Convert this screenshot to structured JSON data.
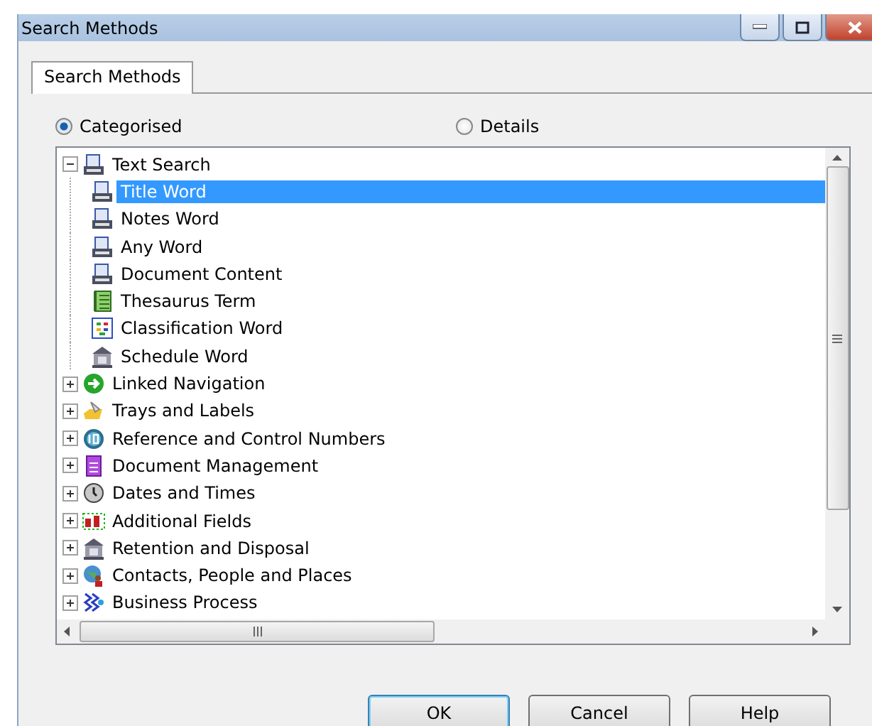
{
  "window": {
    "title": "Search Methods"
  },
  "tabs": [
    {
      "label": "Search Methods",
      "selected": true
    }
  ],
  "view_options": [
    {
      "label": "Categorised",
      "selected": true
    },
    {
      "label": "Details",
      "selected": false
    }
  ],
  "tree": [
    {
      "label": "Text Search",
      "kind": "text",
      "expanded": true,
      "selected": false,
      "children": [
        {
          "label": "Title Word",
          "kind": "text",
          "selected": true
        },
        {
          "label": "Notes Word",
          "kind": "text",
          "selected": false
        },
        {
          "label": "Any Word",
          "kind": "text",
          "selected": false
        },
        {
          "label": "Document Content",
          "kind": "text",
          "selected": false
        },
        {
          "label": "Thesaurus Term",
          "kind": "thesaurus",
          "selected": false
        },
        {
          "label": "Classification Word",
          "kind": "classification",
          "selected": false
        },
        {
          "label": "Schedule Word",
          "kind": "building",
          "selected": false
        }
      ]
    },
    {
      "label": "Linked Navigation",
      "kind": "arrow",
      "expanded": false,
      "selected": false
    },
    {
      "label": "Trays and Labels",
      "kind": "tray",
      "expanded": false,
      "selected": false
    },
    {
      "label": "Reference and Control Numbers",
      "kind": "number",
      "expanded": false,
      "selected": false
    },
    {
      "label": "Document Management",
      "kind": "document",
      "expanded": false,
      "selected": false
    },
    {
      "label": "Dates and Times",
      "kind": "clock",
      "expanded": false,
      "selected": false
    },
    {
      "label": "Additional Fields",
      "kind": "fields",
      "expanded": false,
      "selected": false
    },
    {
      "label": "Retention and Disposal",
      "kind": "building",
      "expanded": false,
      "selected": false
    },
    {
      "label": "Contacts, People and Places",
      "kind": "people",
      "expanded": false,
      "selected": false
    },
    {
      "label": "Business Process",
      "kind": "process",
      "expanded": false,
      "selected": false
    }
  ],
  "buttons": [
    {
      "label": "OK",
      "default": true
    },
    {
      "label": "Cancel",
      "default": false
    },
    {
      "label": "Help",
      "default": false
    }
  ]
}
